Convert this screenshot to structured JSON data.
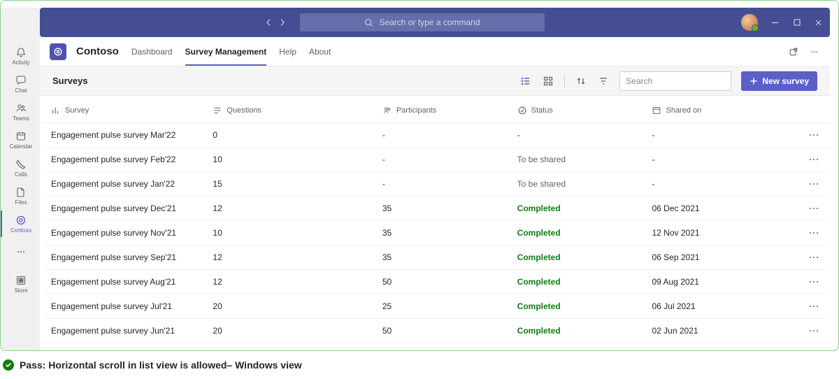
{
  "titlebar": {
    "search_placeholder": "Search or type a command"
  },
  "leftrail": {
    "items": [
      {
        "label": "Activity"
      },
      {
        "label": "Chat"
      },
      {
        "label": "Teams"
      },
      {
        "label": "Calendar"
      },
      {
        "label": "Calls"
      },
      {
        "label": "Files"
      },
      {
        "label": "Contoso"
      },
      {
        "label": ""
      },
      {
        "label": "Store"
      }
    ]
  },
  "app": {
    "name": "Contoso",
    "tabs": [
      "Dashboard",
      "Survey Management",
      "Help",
      "About"
    ],
    "active_tab": 1
  },
  "subbar": {
    "title": "Surveys",
    "search_placeholder": "Search",
    "new_button": "New survey"
  },
  "table": {
    "headers": [
      "Survey",
      "Questions",
      "Participants",
      "Status",
      "Shared on"
    ],
    "rows": [
      {
        "survey": "Engagement pulse survey Mar'22",
        "questions": "0",
        "participants": "-",
        "status": "-",
        "status_kind": "plain",
        "shared": "-"
      },
      {
        "survey": "Engagement pulse survey Feb'22",
        "questions": "10",
        "participants": "-",
        "status": "To be shared",
        "status_kind": "tbs",
        "shared": "-"
      },
      {
        "survey": "Engagement pulse survey Jan'22",
        "questions": "15",
        "participants": "-",
        "status": "To be shared",
        "status_kind": "tbs",
        "shared": "-"
      },
      {
        "survey": "Engagement pulse survey Dec'21",
        "questions": "12",
        "participants": "35",
        "status": "Completed",
        "status_kind": "completed",
        "shared": "06 Dec 2021"
      },
      {
        "survey": "Engagement pulse survey Nov'21",
        "questions": "10",
        "participants": "35",
        "status": "Completed",
        "status_kind": "completed",
        "shared": "12 Nov 2021"
      },
      {
        "survey": "Engagement pulse survey Sep'21",
        "questions": "12",
        "participants": "35",
        "status": "Completed",
        "status_kind": "completed",
        "shared": "06 Sep 2021"
      },
      {
        "survey": "Engagement pulse survey Aug'21",
        "questions": "12",
        "participants": "50",
        "status": "Completed",
        "status_kind": "completed",
        "shared": "09 Aug 2021"
      },
      {
        "survey": "Engagement pulse survey Jul'21",
        "questions": "20",
        "participants": "25",
        "status": "Completed",
        "status_kind": "completed",
        "shared": "06 Jul 2021"
      },
      {
        "survey": "Engagement pulse survey Jun'21",
        "questions": "20",
        "participants": "50",
        "status": "Completed",
        "status_kind": "completed",
        "shared": "02 Jun 2021"
      }
    ]
  },
  "caption": {
    "text": "Pass: Horizontal scroll in list view is allowed– Windows view"
  }
}
